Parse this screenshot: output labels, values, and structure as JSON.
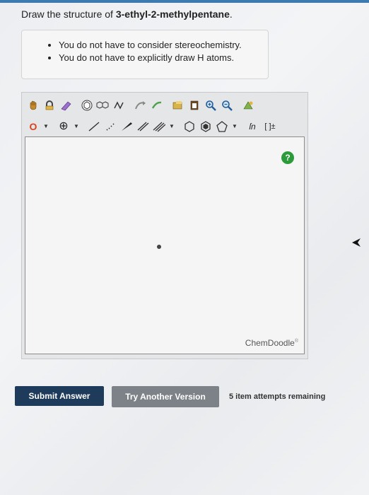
{
  "question": {
    "prefix": "Draw the structure of ",
    "compound": "3-ethyl-2-methylpentane",
    "suffix": "."
  },
  "notes": [
    "You do not have to consider stereochemistry.",
    "You do not have to explicitly draw H atoms."
  ],
  "toolbar": {
    "atom_label": "O",
    "charge_symbol": "⊕",
    "sn_label": "ſn",
    "bracket_label": "[ ]±"
  },
  "canvas": {
    "help_label": "?",
    "brand": "ChemDoodle",
    "brand_mark": "®"
  },
  "actions": {
    "submit_label": "Submit Answer",
    "try_label": "Try Another Version",
    "attempts_text": "5 item attempts remaining"
  },
  "colors": {
    "submit_bg": "#1f3b5c",
    "try_bg": "#7d8288",
    "help_bg": "#2d9a3a",
    "atom_label": "#d9431e"
  }
}
